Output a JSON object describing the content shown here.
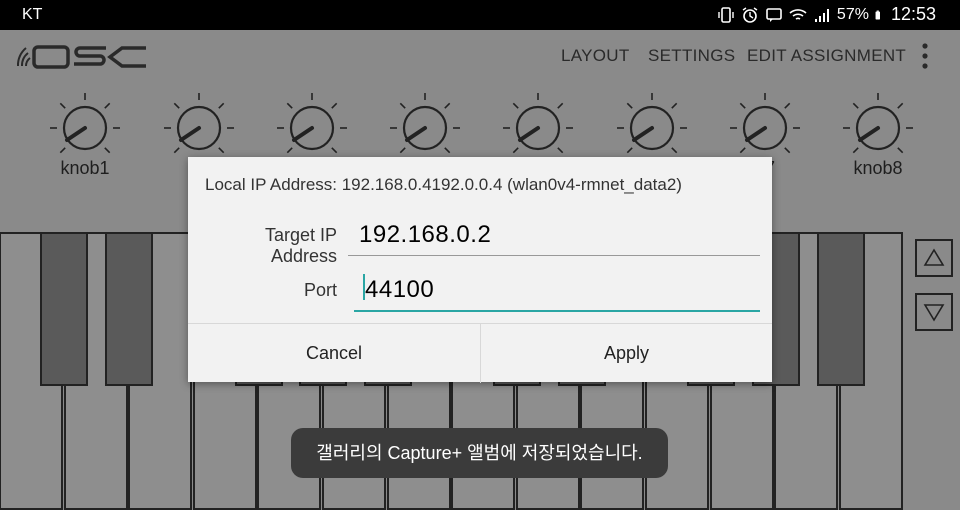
{
  "status_bar": {
    "carrier": "KT",
    "battery": "57%",
    "time": "12:53"
  },
  "app_bar": {
    "logo_text": "OSC",
    "menu": [
      "LAYOUT",
      "SETTINGS",
      "EDIT ASSIGNMENT"
    ]
  },
  "knobs": [
    {
      "label": "knob1"
    },
    {
      "label": "kn"
    },
    {
      "label": ""
    },
    {
      "label": ""
    },
    {
      "label": ""
    },
    {
      "label": ""
    },
    {
      "label": "b7"
    },
    {
      "label": "knob8"
    }
  ],
  "dialog": {
    "local_ip": "Local IP Address: 192.168.0.4192.0.0.4  (wlan0v4-rmnet_data2)",
    "target_ip_label": "Target IP Address",
    "target_ip_value": "192.168.0.2",
    "port_label": "Port",
    "port_value": "44100",
    "cancel_label": "Cancel",
    "apply_label": "Apply"
  },
  "toast": {
    "text": "갤러리의 Capture+ 앨범에 저장되었습니다."
  },
  "colors": {
    "accent": "#2aa6a4",
    "background": "#8a8a8a",
    "dialog": "#f2f2f2"
  }
}
